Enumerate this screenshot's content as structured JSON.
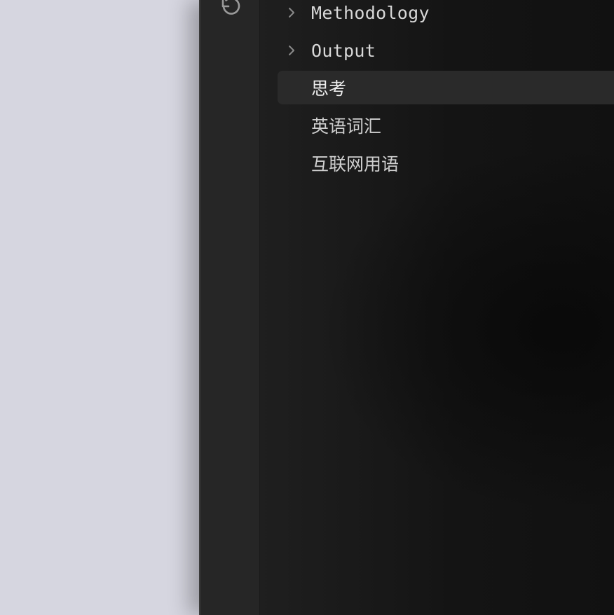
{
  "ribbon": {
    "undo_icon": "undo-icon"
  },
  "file_tree": {
    "items": [
      {
        "label": "Methodology",
        "type": "folder",
        "collapsed": true
      },
      {
        "label": "Output",
        "type": "folder",
        "collapsed": true
      },
      {
        "label": "思考",
        "type": "file",
        "active": true
      },
      {
        "label": "英语词汇",
        "type": "file"
      },
      {
        "label": "互联网用语",
        "type": "file"
      }
    ]
  },
  "colors": {
    "desktop": "#d6d6e0",
    "window": "#1f1f1f",
    "text": "#d8d8d8",
    "active_row": "#2a2a2a"
  }
}
